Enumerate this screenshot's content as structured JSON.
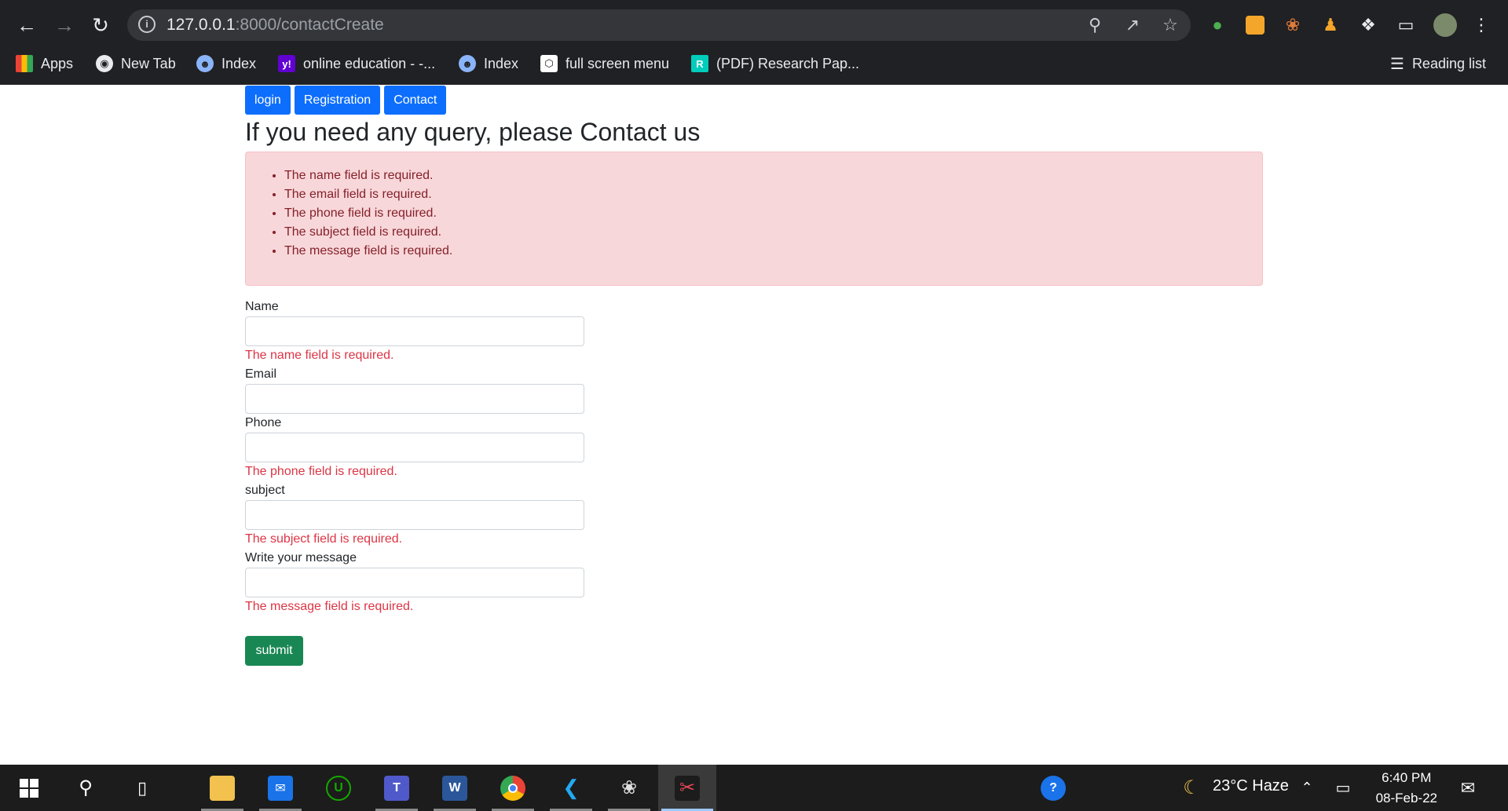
{
  "browser": {
    "url_host": "127.0.0.1",
    "url_path": ":8000/contactCreate",
    "bookmarks": [
      {
        "label": "Apps",
        "icon": "apps-grid-icon"
      },
      {
        "label": "New Tab",
        "icon": "globe-icon"
      },
      {
        "label": "Index",
        "icon": "index-favicon-icon"
      },
      {
        "label": "online education - -...",
        "icon": "yahoo-icon"
      },
      {
        "label": "Index",
        "icon": "index-favicon-icon"
      },
      {
        "label": "full screen menu",
        "icon": "codepen-icon"
      },
      {
        "label": "(PDF) Research Pap...",
        "icon": "researchgate-icon"
      }
    ],
    "reading_list": "Reading list"
  },
  "page": {
    "nav": [
      "login",
      "Registration",
      "Contact"
    ],
    "heading": "If you need any query, please Contact us",
    "alert_errors": [
      "The name field is required.",
      "The email field is required.",
      "The phone field is required.",
      "The subject field is required.",
      "The message field is required."
    ],
    "form": {
      "name_label": "Name",
      "name_error": "The name field is required.",
      "email_label": "Email",
      "phone_label": "Phone",
      "phone_error": "The phone field is required.",
      "subject_label": "subject",
      "subject_error": "The subject field is required.",
      "message_label": "Write your message",
      "message_error": "The message field is required.",
      "submit_label": "submit"
    }
  },
  "taskbar": {
    "weather": "23°C  Haze",
    "time": "6:40 PM",
    "date": "08-Feb-22"
  },
  "colors": {
    "primary": "#0d6efd",
    "success": "#198754",
    "danger": "#dc3545",
    "alert_bg": "#f8d7da",
    "alert_text": "#842029"
  }
}
